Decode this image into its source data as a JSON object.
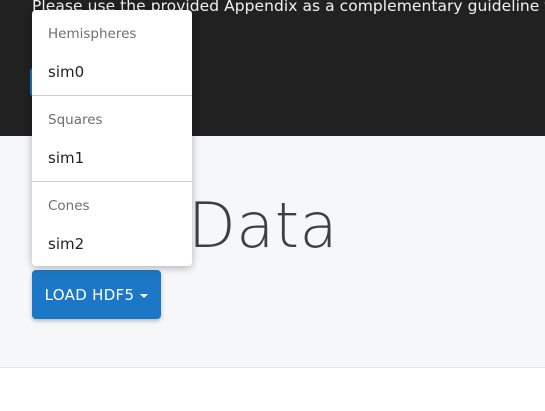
{
  "intro": {
    "text": "Please use the provided Appendix as a complementary guideline to run t"
  },
  "section": {
    "title": "Data"
  },
  "load_button": {
    "label": "LOAD HDF5"
  },
  "dropdown": {
    "groups": [
      {
        "header": "Hemispheres",
        "item": "sim0"
      },
      {
        "header": "Squares",
        "item": "sim1"
      },
      {
        "header": "Cones",
        "item": "sim2"
      }
    ]
  },
  "colors": {
    "dark_band": "#212121",
    "light_band": "#f6f7f9",
    "accent": "#1c78c7"
  },
  "icons": {
    "button_caret": "caret-down-icon"
  }
}
